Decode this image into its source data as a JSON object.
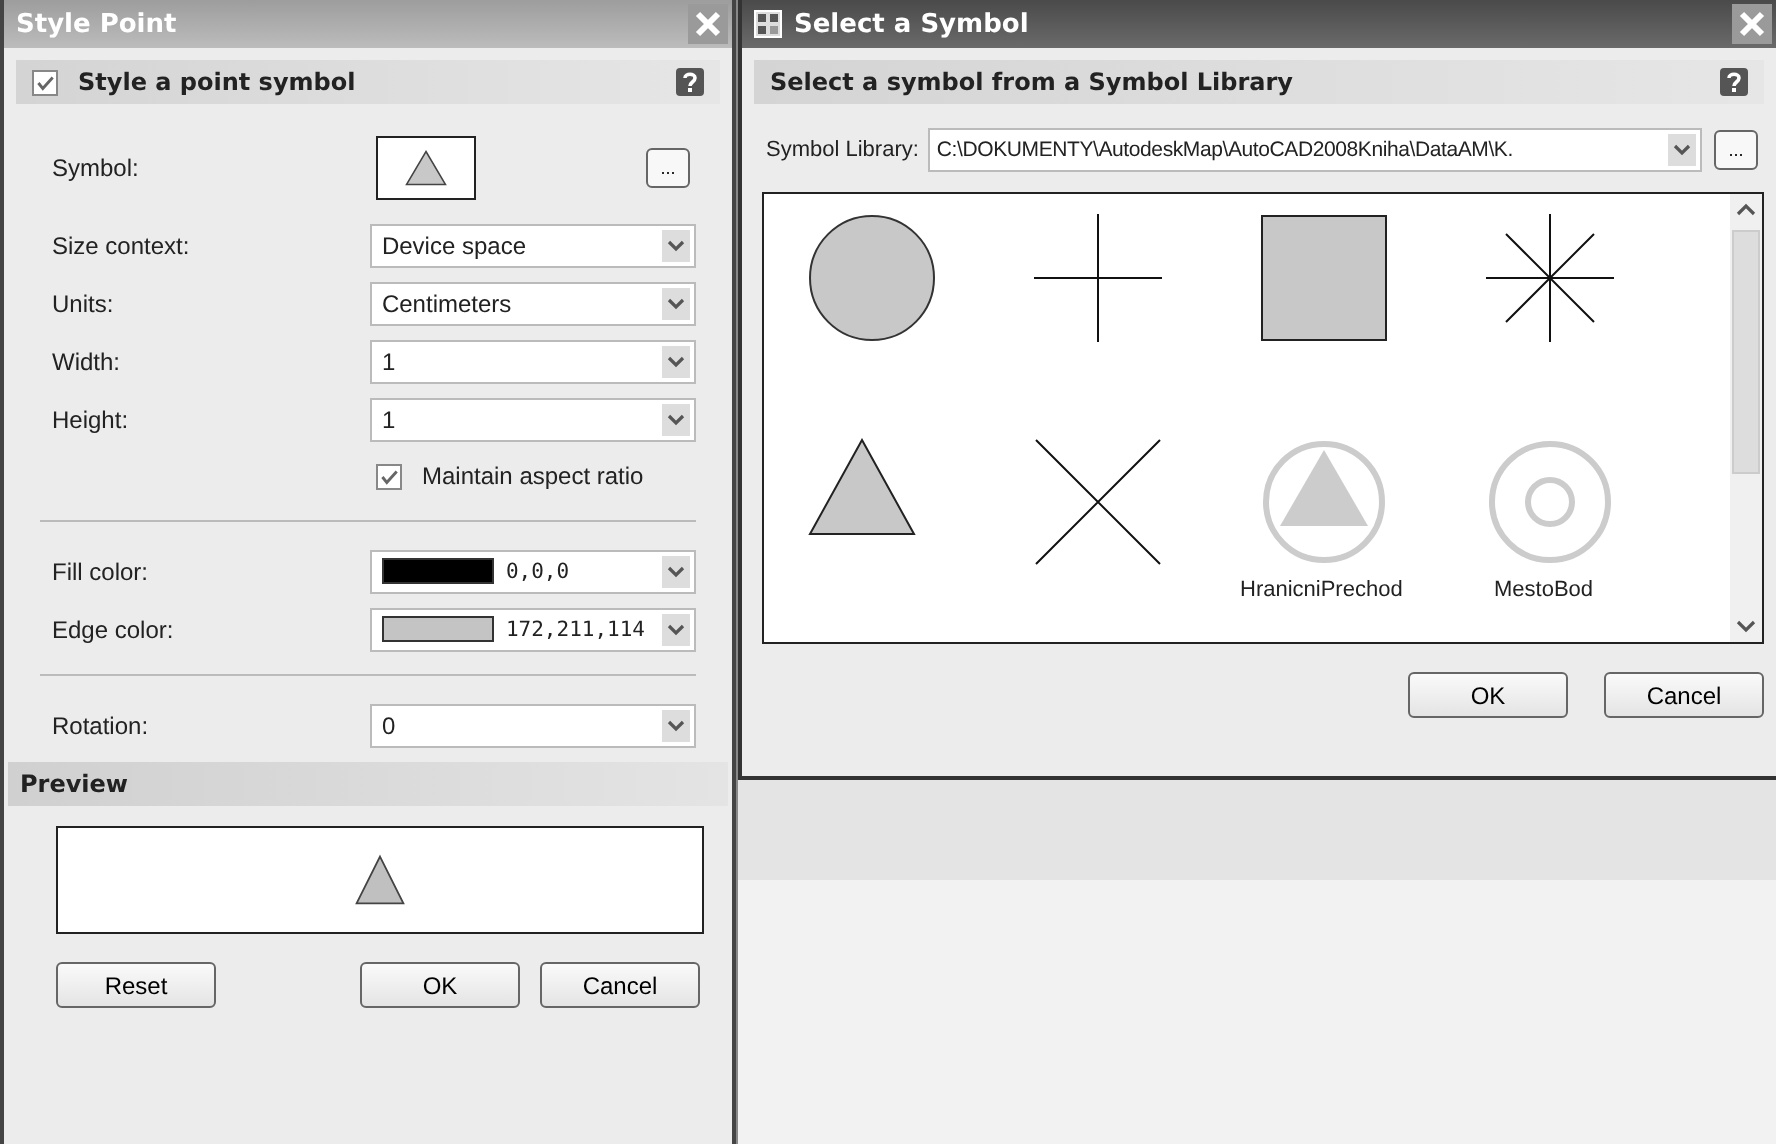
{
  "style_point": {
    "title": "Style Point",
    "section": {
      "title": "Style a point symbol",
      "checked": true
    },
    "fields": [
      {
        "kind": "symbol",
        "label": "Symbol:",
        "browse": "..."
      },
      {
        "kind": "select",
        "label": "Size context:",
        "value": "Device space"
      },
      {
        "kind": "select",
        "label": "Units:",
        "value": "Centimeters"
      },
      {
        "kind": "select",
        "label": "Width:",
        "value": "1"
      },
      {
        "kind": "select",
        "label": "Height:",
        "value": "1"
      },
      {
        "kind": "checkbox",
        "label": "Maintain aspect ratio",
        "checked": true
      },
      {
        "kind": "divider"
      },
      {
        "kind": "color",
        "label": "Fill color:",
        "value": "0,0,0",
        "color": "#000000"
      },
      {
        "kind": "color",
        "label": "Edge color:",
        "value": "172,211,114",
        "color": "#c4c4c4"
      },
      {
        "kind": "divider"
      },
      {
        "kind": "select",
        "label": "Rotation:",
        "value": "0"
      }
    ],
    "preview_title": "Preview",
    "buttons": [
      {
        "label": "Reset"
      },
      {
        "label": "OK"
      },
      {
        "label": "Cancel"
      }
    ]
  },
  "select_symbol": {
    "title": "Select a Symbol",
    "header": "Select a symbol from a Symbol Library",
    "library_label": "Symbol Library:",
    "library_value": "C:\\DOKUMENTY\\AutodeskMap\\AutoCAD2008Kniha\\DataAM\\K.",
    "browse": "...",
    "symbols": [
      {
        "kind": "circle"
      },
      {
        "kind": "plus"
      },
      {
        "kind": "square"
      },
      {
        "kind": "star"
      },
      {
        "kind": "triangle"
      },
      {
        "kind": "cross"
      },
      {
        "kind": "ring-triangle",
        "label": "HranicniPrechod"
      },
      {
        "kind": "ring-ring",
        "label": "MestoBod"
      }
    ],
    "buttons": [
      {
        "label": "OK"
      },
      {
        "label": "Cancel"
      }
    ]
  }
}
